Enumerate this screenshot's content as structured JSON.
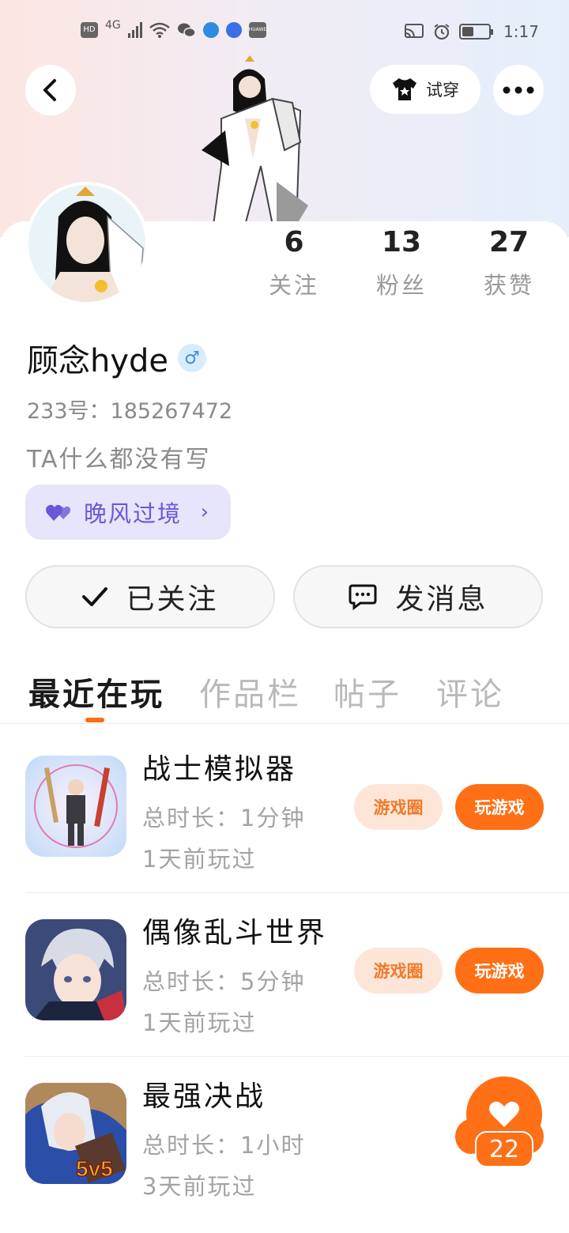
{
  "status_bar": {
    "left_icons": [
      "hd-icon",
      "signal-4g-icon",
      "wifi-icon",
      "wechat-icon",
      "app-blue-icon",
      "music-icon",
      "huawei-icon"
    ],
    "hd": "HD",
    "network": "4G",
    "time": "1:17",
    "battery_level": 0.45
  },
  "header": {
    "try_on_label": "试穿"
  },
  "profile": {
    "name": "顾念hyde",
    "gender_symbol": "♂",
    "uid_label": "233号：",
    "uid": "185267472",
    "bio": "TA什么都没有写",
    "stats": [
      {
        "num": "6",
        "label": "关注"
      },
      {
        "num": "13",
        "label": "粉丝"
      },
      {
        "num": "27",
        "label": "获赞"
      }
    ],
    "relation_label": "晚风过境",
    "follow_label": "已关注",
    "message_label": "发消息"
  },
  "tabs": [
    {
      "label": "最近在玩",
      "active": true
    },
    {
      "label": "作品栏",
      "active": false
    },
    {
      "label": "帖子",
      "active": false
    },
    {
      "label": "评论",
      "active": false
    }
  ],
  "games": [
    {
      "title": "战士模拟器",
      "duration": "总时长：1分钟",
      "last_played": "1天前玩过",
      "circle_label": "游戏圈",
      "play_label": "玩游戏"
    },
    {
      "title": "偶像乱斗世界",
      "duration": "总时长：5分钟",
      "last_played": "1天前玩过",
      "circle_label": "游戏圈",
      "play_label": "玩游戏"
    },
    {
      "title": "最强决战",
      "duration": "总时长：1小时",
      "last_played": "3天前玩过",
      "icon_badge": "5v5"
    }
  ],
  "floating_like": {
    "count": "22"
  },
  "colors": {
    "accent": "#ff6f16",
    "accent_light": "#fde6d8",
    "purple": "#6a58d8",
    "gender_blue": "#3b8fe0"
  }
}
